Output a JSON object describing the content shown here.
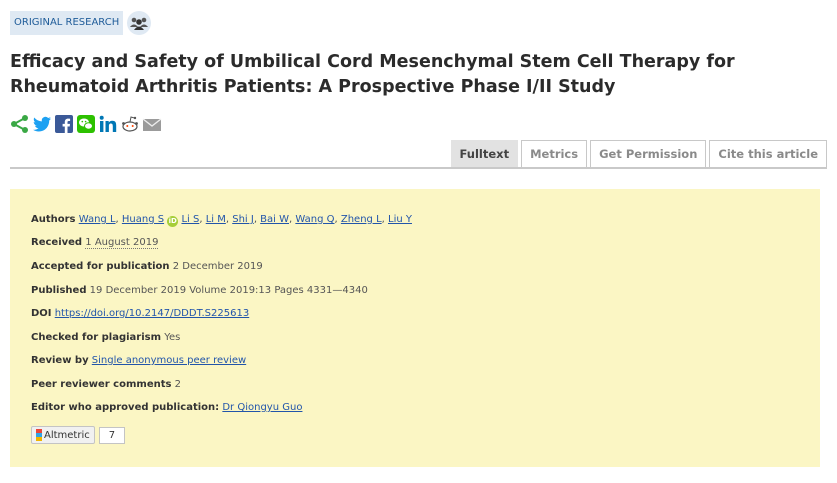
{
  "header": {
    "badge": "ORIGINAL RESEARCH",
    "title": "Efficacy and Safety of Umbilical Cord Mesenchymal Stem Cell Therapy for Rheumatoid Arthritis Patients: A Prospective Phase I/II Study"
  },
  "share": {
    "icons": [
      "share-icon",
      "twitter-icon",
      "facebook-icon",
      "wechat-icon",
      "linkedin-icon",
      "reddit-icon",
      "email-icon"
    ]
  },
  "tabs": [
    "Fulltext",
    "Metrics",
    "Get Permission",
    "Cite this article"
  ],
  "info": {
    "authors_label": "Authors",
    "authors": [
      "Wang L",
      "Huang S",
      "Li S",
      "Li M",
      "Shi J",
      "Bai W",
      "Wang Q",
      "Zheng L",
      "Liu Y"
    ],
    "received_label": "Received",
    "received": "1 August 2019",
    "accepted_label": "Accepted for publication",
    "accepted": "2 December 2019",
    "published_label": "Published",
    "published": "19 December 2019 Volume 2019:13 Pages 4331—4340",
    "doi_label": "DOI",
    "doi": "https://doi.org/10.2147/DDDT.S225613",
    "plagiarism_label": "Checked for plagiarism",
    "plagiarism": "Yes",
    "review_label": "Review by",
    "review": "Single anonymous peer review",
    "comments_label": "Peer reviewer comments",
    "comments": "2",
    "editor_label": "Editor who approved publication:",
    "editor": "Dr Qiongyu Guo",
    "altmetric_label": "Altmetric",
    "altmetric_score": "7"
  },
  "colors": {
    "badge_bg": "#dfe9f3",
    "panel_bg": "#fbf6c4",
    "link": "#2255aa",
    "share_green": "#3aa845",
    "twitter": "#1da1f2",
    "facebook": "#3b5998",
    "wechat": "#2dc100",
    "linkedin": "#0077b5"
  }
}
